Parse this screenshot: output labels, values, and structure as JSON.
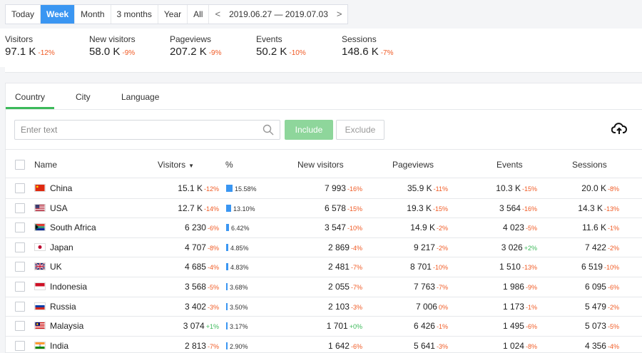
{
  "range": {
    "segments": [
      "Today",
      "Week",
      "Month",
      "3 months",
      "Year",
      "All"
    ],
    "active": "Week",
    "date_range": "2019.06.27 — 2019.07.03",
    "prev_icon": "chevron-left-icon",
    "next_icon": "chevron-right-icon"
  },
  "metrics": [
    {
      "label": "Visitors",
      "value": "97.1 K",
      "change": "-12%"
    },
    {
      "label": "New visitors",
      "value": "58.0 K",
      "change": "-9%"
    },
    {
      "label": "Pageviews",
      "value": "207.2 K",
      "change": "-9%"
    },
    {
      "label": "Events",
      "value": "50.2 K",
      "change": "-10%"
    },
    {
      "label": "Sessions",
      "value": "148.6 K",
      "change": "-7%"
    }
  ],
  "tabs": [
    "Country",
    "City",
    "Language"
  ],
  "active_tab": "Country",
  "filter": {
    "placeholder": "Enter text",
    "include_label": "Include",
    "exclude_label": "Exclude"
  },
  "table": {
    "headers": {
      "name": "Name",
      "visitors": "Visitors",
      "sort_indicator": "▼",
      "pct": "%",
      "new_visitors": "New visitors",
      "pageviews": "Pageviews",
      "events": "Events",
      "sessions": "Sessions"
    },
    "rows": [
      {
        "name": "China",
        "visitors": "15.1 K",
        "visitors_chg": "-12%",
        "pct": "15.58%",
        "pct_value": 15.58,
        "new_visitors": "7 993",
        "new_visitors_chg": "-16%",
        "pageviews": "35.9 K",
        "pageviews_chg": "-11%",
        "events": "10.3 K",
        "events_chg": "-15%",
        "sessions": "20.0 K",
        "sessions_chg": "-8%"
      },
      {
        "name": "USA",
        "visitors": "12.7 K",
        "visitors_chg": "-14%",
        "pct": "13.10%",
        "pct_value": 13.1,
        "new_visitors": "6 578",
        "new_visitors_chg": "-15%",
        "pageviews": "19.3 K",
        "pageviews_chg": "-15%",
        "events": "3 564",
        "events_chg": "-16%",
        "sessions": "14.3 K",
        "sessions_chg": "-13%"
      },
      {
        "name": "South Africa",
        "visitors": "6 230",
        "visitors_chg": "-6%",
        "pct": "6.42%",
        "pct_value": 6.42,
        "new_visitors": "3 547",
        "new_visitors_chg": "-10%",
        "pageviews": "14.9 K",
        "pageviews_chg": "-2%",
        "events": "4 023",
        "events_chg": "-5%",
        "sessions": "11.6 K",
        "sessions_chg": "-1%"
      },
      {
        "name": "Japan",
        "visitors": "4 707",
        "visitors_chg": "-8%",
        "pct": "4.85%",
        "pct_value": 4.85,
        "new_visitors": "2 869",
        "new_visitors_chg": "-4%",
        "pageviews": "9 217",
        "pageviews_chg": "-2%",
        "events": "3 026",
        "events_chg": "+2%",
        "sessions": "7 422",
        "sessions_chg": "-2%"
      },
      {
        "name": "UK",
        "visitors": "4 685",
        "visitors_chg": "-4%",
        "pct": "4.83%",
        "pct_value": 4.83,
        "new_visitors": "2 481",
        "new_visitors_chg": "-7%",
        "pageviews": "8 701",
        "pageviews_chg": "-10%",
        "events": "1 510",
        "events_chg": "-13%",
        "sessions": "6 519",
        "sessions_chg": "-10%"
      },
      {
        "name": "Indonesia",
        "visitors": "3 568",
        "visitors_chg": "-5%",
        "pct": "3.68%",
        "pct_value": 3.68,
        "new_visitors": "2 055",
        "new_visitors_chg": "-7%",
        "pageviews": "7 763",
        "pageviews_chg": "-7%",
        "events": "1 986",
        "events_chg": "-9%",
        "sessions": "6 095",
        "sessions_chg": "-6%"
      },
      {
        "name": "Russia",
        "visitors": "3 402",
        "visitors_chg": "-3%",
        "pct": "3.50%",
        "pct_value": 3.5,
        "new_visitors": "2 103",
        "new_visitors_chg": "-3%",
        "pageviews": "7 006",
        "pageviews_chg": "0%",
        "events": "1 173",
        "events_chg": "-1%",
        "sessions": "5 479",
        "sessions_chg": "-2%"
      },
      {
        "name": "Malaysia",
        "visitors": "3 074",
        "visitors_chg": "+1%",
        "pct": "3.17%",
        "pct_value": 3.17,
        "new_visitors": "1 701",
        "new_visitors_chg": "+0%",
        "pageviews": "6 426",
        "pageviews_chg": "-1%",
        "events": "1 495",
        "events_chg": "-6%",
        "sessions": "5 073",
        "sessions_chg": "-5%"
      },
      {
        "name": "India",
        "visitors": "2 813",
        "visitors_chg": "-7%",
        "pct": "2.90%",
        "pct_value": 2.9,
        "new_visitors": "1 642",
        "new_visitors_chg": "-6%",
        "pageviews": "5 641",
        "pageviews_chg": "-3%",
        "events": "1 024",
        "events_chg": "-8%",
        "sessions": "4 356",
        "sessions_chg": "-4%"
      }
    ]
  },
  "colors": {
    "accent_blue": "#3a96f2",
    "accent_green": "#3cb95a",
    "negative": "#f05a24",
    "positive": "#3cb95a",
    "include_button": "#8ed69b"
  },
  "icons": {
    "search": "search-icon",
    "upload": "cloud-upload-icon"
  }
}
